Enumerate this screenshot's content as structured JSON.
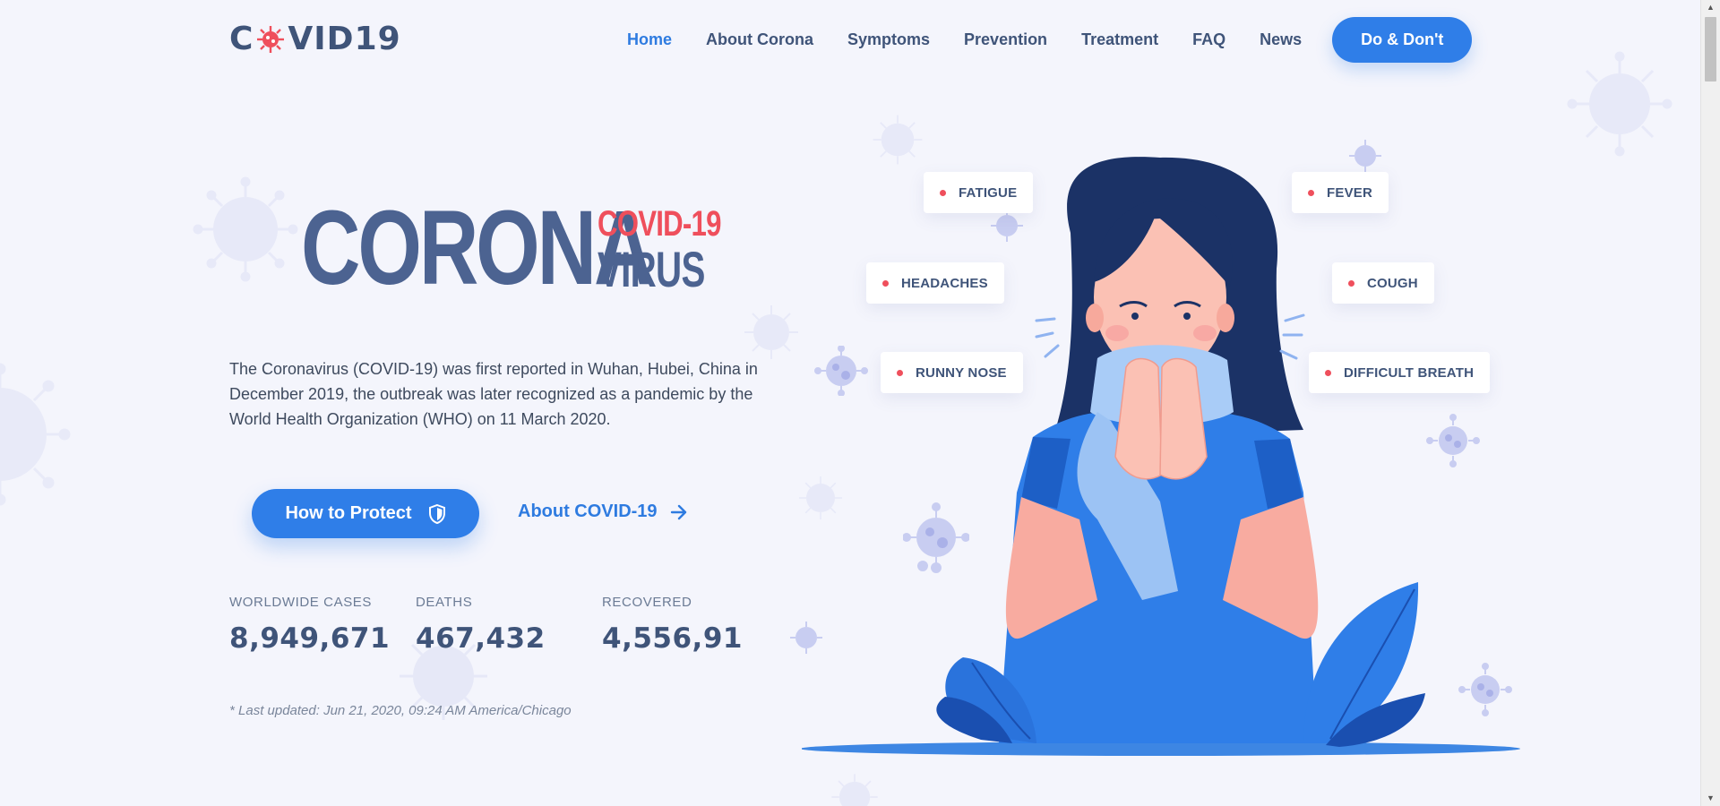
{
  "header": {
    "logo": {
      "prefix": "C",
      "suffix": "VID",
      "number": "19"
    },
    "nav": [
      {
        "label": "Home",
        "active": true
      },
      {
        "label": "About Corona"
      },
      {
        "label": "Symptoms"
      },
      {
        "label": "Prevention"
      },
      {
        "label": "Treatment"
      },
      {
        "label": "FAQ"
      },
      {
        "label": "News"
      }
    ],
    "cta_label": "Do & Don't"
  },
  "hero": {
    "title_big": "CORONA",
    "title_small_top": "COVID-19",
    "title_small_bottom": "VIRUS",
    "intro": "The Coronavirus (COVID-19) was first reported in Wuhan, Hubei, China in December 2019, the outbreak was later recognized as a pandemic by the World Health Organization (WHO) on 11 March 2020.",
    "primary_button": "How to Protect",
    "secondary_link": "About COVID-19"
  },
  "stats": [
    {
      "label": "WORLDWIDE CASES",
      "value": "8,949,671"
    },
    {
      "label": "DEATHS",
      "value": "467,432"
    },
    {
      "label": "RECOVERED",
      "value": "4,556,91"
    }
  ],
  "updated": "* Last updated: Jun 21, 2020, 09:24 AM America/Chicago",
  "symptoms": [
    "FATIGUE",
    "FEVER",
    "HEADACHES",
    "COUGH",
    "RUNNY NOSE",
    "DIFFICULT BREATH"
  ],
  "colors": {
    "accent_blue": "#2f7ee8",
    "accent_red": "#ef4f5c",
    "text_navy": "#3f5479",
    "background": "#f4f5fc"
  },
  "icons": {
    "logo_o": "virus-icon",
    "protect": "shield-icon",
    "about": "arrow-right-icon"
  }
}
